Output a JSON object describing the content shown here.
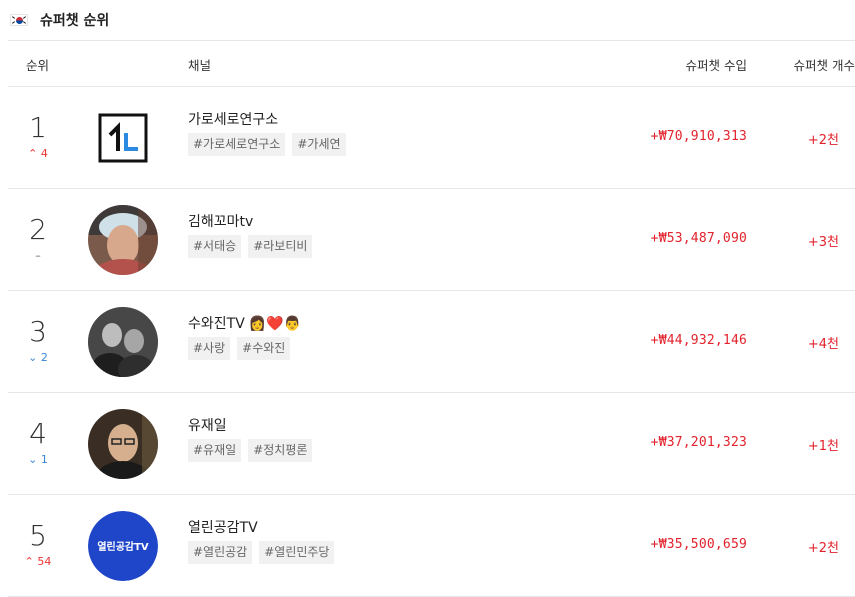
{
  "header": {
    "title": "슈퍼챗 순위",
    "flag_icon": "south-korea-flag-icon"
  },
  "columns": {
    "rank": "순위",
    "channel": "채널",
    "revenue": "슈퍼챗 수입",
    "count": "슈퍼챗 개수"
  },
  "rows": [
    {
      "rank": "1",
      "change": "4",
      "direction": "up",
      "name": "가로세로연구소",
      "emoji": "",
      "tags": [
        "#가로세로연구소",
        "#가세연"
      ],
      "revenue": "+₩70,910,313",
      "count": "+2천"
    },
    {
      "rank": "2",
      "change": "–",
      "direction": "same",
      "name": "김해꼬마tv",
      "emoji": "",
      "tags": [
        "#서태승",
        "#라보티비"
      ],
      "revenue": "+₩53,487,090",
      "count": "+3천"
    },
    {
      "rank": "3",
      "change": "2",
      "direction": "down",
      "name": "수와진TV",
      "emoji": "👩❤️👨",
      "tags": [
        "#사랑",
        "#수와진"
      ],
      "revenue": "+₩44,932,146",
      "count": "+4천"
    },
    {
      "rank": "4",
      "change": "1",
      "direction": "down",
      "name": "유재일",
      "emoji": "",
      "tags": [
        "#유재일",
        "#정치평론"
      ],
      "revenue": "+₩37,201,323",
      "count": "+1천"
    },
    {
      "rank": "5",
      "change": "54",
      "direction": "up",
      "name": "열린공감TV",
      "emoji": "",
      "logo_text": "열린공감TV",
      "tags": [
        "#열린공감",
        "#열린민주당"
      ],
      "revenue": "+₩35,500,659",
      "count": "+2천"
    }
  ]
}
